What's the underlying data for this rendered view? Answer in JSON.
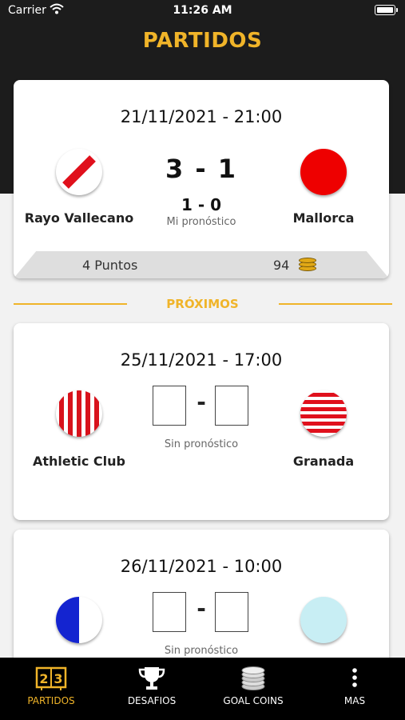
{
  "status_bar": {
    "carrier": "Carrier",
    "time": "11:26 AM"
  },
  "header": {
    "title": "PARTIDOS"
  },
  "played_match": {
    "datetime": "21/11/2021 - 21:00",
    "home_team": "Rayo Vallecano",
    "away_team": "Mallorca",
    "score": "3 - 1",
    "my_prediction": "1 - 0",
    "my_prediction_caption": "Mi pronóstico",
    "points": "4 Puntos",
    "coins": "94",
    "home_crest": "rayo-vallecano-crest-icon",
    "away_crest": "mallorca-crest-icon"
  },
  "section": {
    "label": "PRÓXIMOS"
  },
  "upcoming": [
    {
      "datetime": "25/11/2021 - 17:00",
      "home_team": "Athletic Club",
      "away_team": "Granada",
      "separator": "-",
      "caption": "Sin pronóstico",
      "home_crest": "athletic-club-crest-icon",
      "away_crest": "granada-crest-icon"
    },
    {
      "datetime": "26/11/2021 - 10:00",
      "home_team": "",
      "away_team": "",
      "separator": "-",
      "caption": "Sin pronóstico",
      "home_crest": "blue-white-crest-icon",
      "away_crest": "light-blue-crest-icon"
    }
  ],
  "tabbar": {
    "items": [
      {
        "label": "PARTIDOS",
        "icon": "scoreboard-icon",
        "active": true
      },
      {
        "label": "DESAFIOS",
        "icon": "trophy-icon",
        "active": false
      },
      {
        "label": "GOAL COINS",
        "icon": "coin-stack-icon",
        "active": false
      },
      {
        "label": "MAS",
        "icon": "more-vertical-icon",
        "active": false
      }
    ],
    "scoreboard_digits": "23"
  },
  "colors": {
    "accent": "#f0b429",
    "header_bg": "#1c1c1c",
    "tabbar_bg": "#000000",
    "rayo_red": "#e0101c",
    "mallorca_red": "#ee0000",
    "athletic_red": "#d8121c",
    "granada_red": "#e0101c",
    "blue_crest": "#1424d0",
    "light_blue_crest": "#c8eef4"
  }
}
